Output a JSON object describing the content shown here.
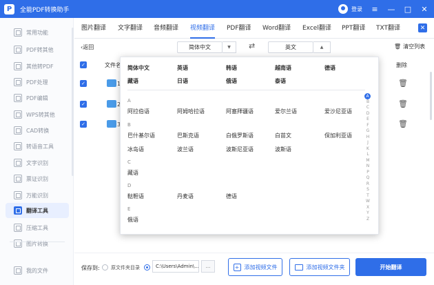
{
  "app": {
    "title": "全能PDF转换助手",
    "logo_char": "P",
    "login": "登录"
  },
  "sidebar": {
    "items": [
      {
        "label": "常用功能"
      },
      {
        "label": "PDF转其他"
      },
      {
        "label": "其他转PDF"
      },
      {
        "label": "PDF处理"
      },
      {
        "label": "PDF编辑"
      },
      {
        "label": "WPS转其他"
      },
      {
        "label": "CAD转换"
      },
      {
        "label": "转语音工具"
      },
      {
        "label": "文字识别"
      },
      {
        "label": "票证识别"
      },
      {
        "label": "万能识别"
      },
      {
        "label": "翻译工具",
        "active": true
      },
      {
        "label": "压缩工具"
      },
      {
        "label": "图片转换"
      }
    ],
    "bottom_item": "我的文件"
  },
  "tabs": [
    {
      "label": "图片翻译"
    },
    {
      "label": "文字翻译"
    },
    {
      "label": "音频翻译"
    },
    {
      "label": "视频翻译",
      "active": true
    },
    {
      "label": "PDF翻译"
    },
    {
      "label": "Word翻译"
    },
    {
      "label": "Excel翻译"
    },
    {
      "label": "PPT翻译"
    },
    {
      "label": "TXT翻译"
    }
  ],
  "toolbar": {
    "back": "返回",
    "source_lang": "简体中文",
    "target_lang": "英文",
    "clear_list": "清空列表"
  },
  "table": {
    "col_file": "文件名",
    "col_delete": "删除",
    "rows": [
      {
        "index": "1"
      },
      {
        "index": "2"
      },
      {
        "index": "3"
      }
    ]
  },
  "dropdown": {
    "popular": [
      [
        "简体中文",
        "英语",
        "韩语",
        "越南语",
        "德语"
      ],
      [
        "藏语",
        "日语",
        "俄语",
        "泰语"
      ]
    ],
    "groups": [
      {
        "letter": "A",
        "langs": [
          "阿拉伯语",
          "阿姆哈拉语",
          "阿塞拜疆语",
          "爱尔兰语",
          "爱沙尼亚语"
        ]
      },
      {
        "letter": "B",
        "langs": [
          "巴什基尔语",
          "巴斯克语",
          "白俄罗斯语",
          "白苗文",
          "保加利亚语",
          "冰岛语",
          "波兰语",
          "波斯尼亚语",
          "波斯语"
        ]
      },
      {
        "letter": "C",
        "langs": [
          "藏语"
        ]
      },
      {
        "letter": "D",
        "langs": [
          "鞑靼语",
          "丹麦语",
          "德语"
        ]
      },
      {
        "letter": "E",
        "langs": [
          "俄语"
        ]
      }
    ],
    "alphabet": [
      "A",
      "B",
      "C",
      "D",
      "E",
      "F",
      "G",
      "H",
      "J",
      "K",
      "L",
      "M",
      "N",
      "P",
      "Q",
      "R",
      "S",
      "T",
      "W",
      "X",
      "Y",
      "Z"
    ]
  },
  "bottom": {
    "save_to": "保存到:",
    "original_dir": "原文件夹目录",
    "path": "C:\\Users\\Admin\\...",
    "browse": "...",
    "add_video": "添加视频文件",
    "add_folder": "添加视频文件夹",
    "start": "开始翻译"
  },
  "colors": {
    "accent": "#2f6ee8"
  }
}
